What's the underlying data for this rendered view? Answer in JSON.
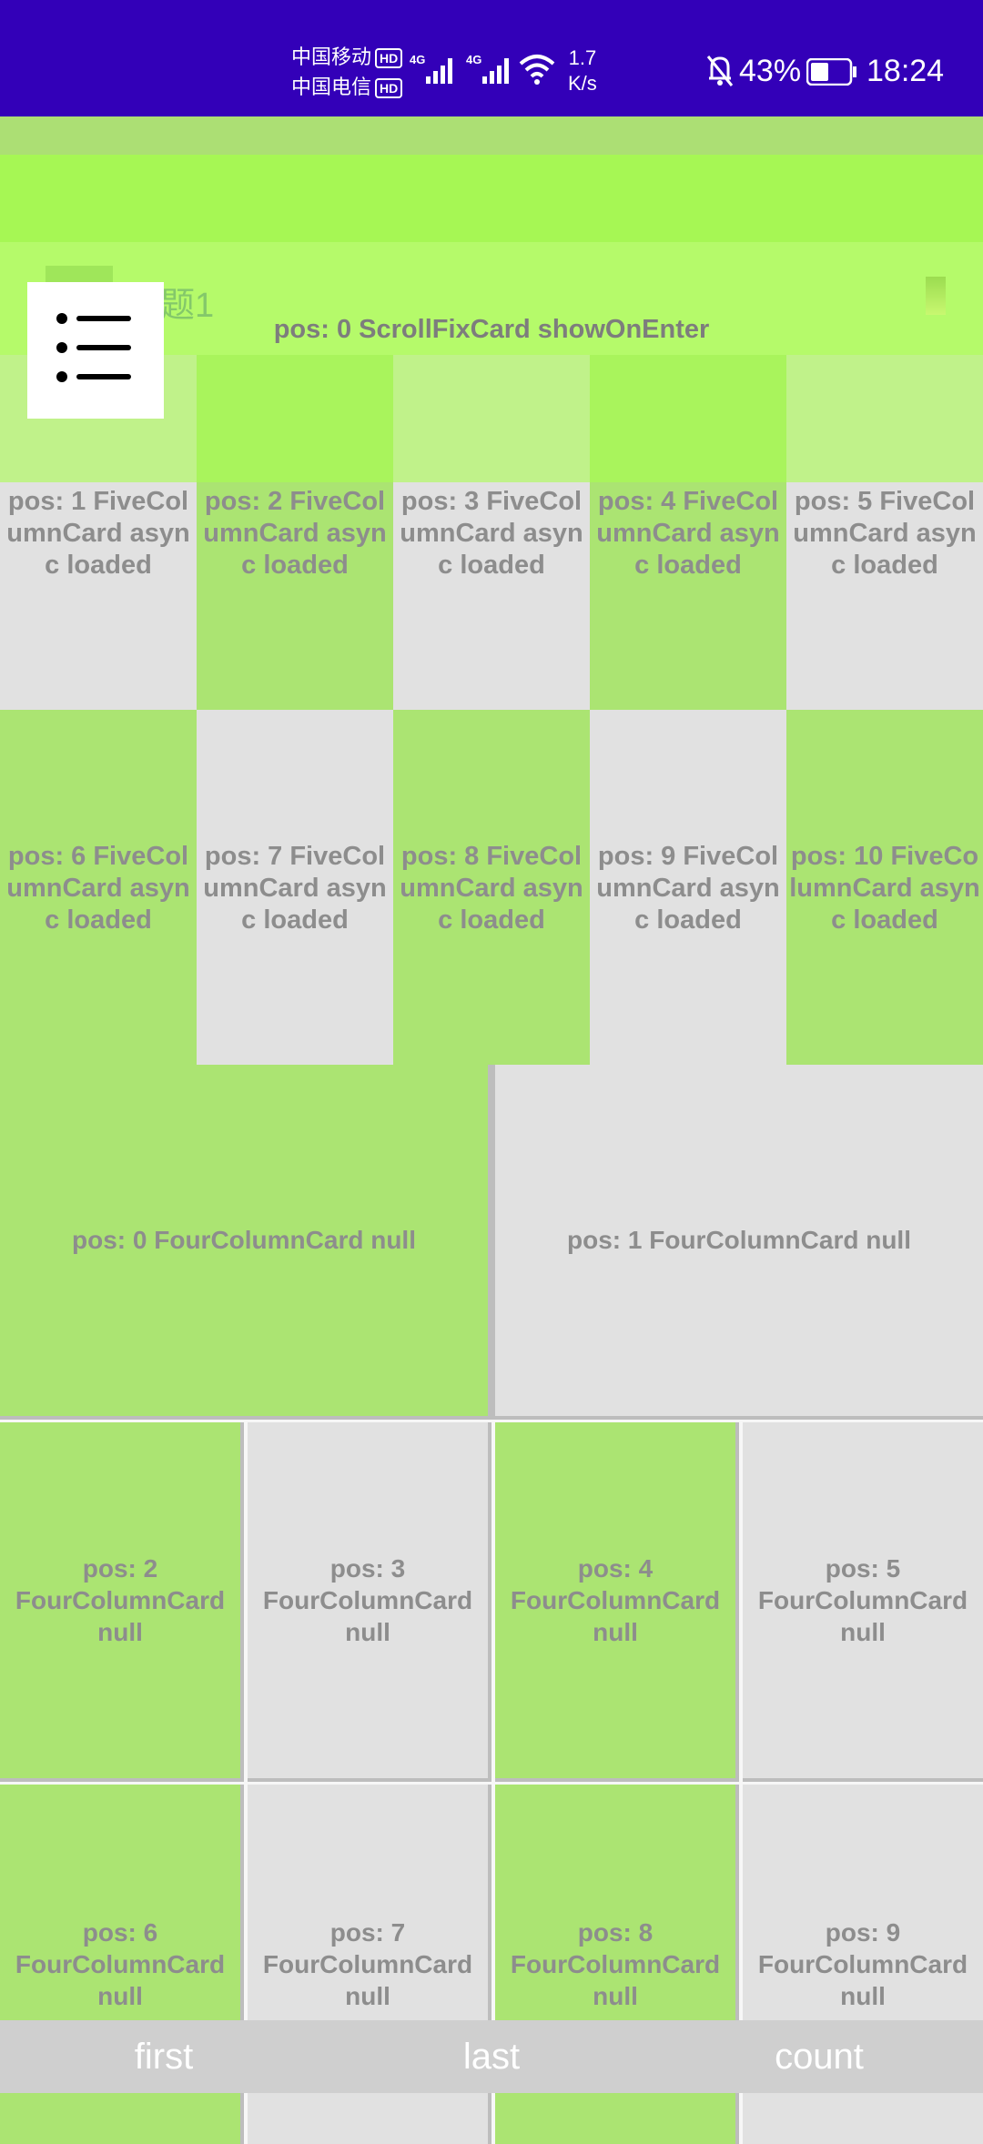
{
  "status_bar": {
    "carrier1": "中国移动",
    "carrier2": "中国电信",
    "hd": "HD",
    "network": "4G",
    "speed_value": "1.7",
    "speed_unit": "K/s",
    "battery": "43%",
    "time": "18:24"
  },
  "header": {
    "tab_label": "题1",
    "scroll_fix_title": "pos: 0 ScrollFixCard showOnEnter"
  },
  "five_column_cards": [
    "pos: 1 FiveColumnCard async loaded",
    "pos: 2 FiveColumnCard async loaded",
    "pos: 3 FiveColumnCard async loaded",
    "pos: 4 FiveColumnCard async loaded",
    "pos: 5 FiveColumnCard async loaded",
    "pos: 6 FiveColumnCard async loaded",
    "pos: 7 FiveColumnCard async loaded",
    "pos: 8 FiveColumnCard async loaded",
    "pos: 9 FiveColumnCard async loaded",
    "pos: 10 FiveColumnCard async loaded"
  ],
  "four_column_cards": [
    "pos: 0 FourColumnCard null",
    "pos: 1 FourColumnCard null",
    "pos: 2 FourColumnCard null",
    "pos: 3 FourColumnCard null",
    "pos: 4 FourColumnCard null",
    "pos: 5 FourColumnCard null",
    "pos: 6 FourColumnCard null",
    "pos: 7 FourColumnCard null",
    "pos: 8 FourColumnCard null",
    "pos: 9 FourColumnCard null"
  ],
  "bottom_bar": {
    "first": "first",
    "last": "last",
    "count": "count"
  },
  "colors": {
    "status_bar": "#3300b8",
    "card_green": "#abe472",
    "card_gray": "#e1e1e1"
  }
}
